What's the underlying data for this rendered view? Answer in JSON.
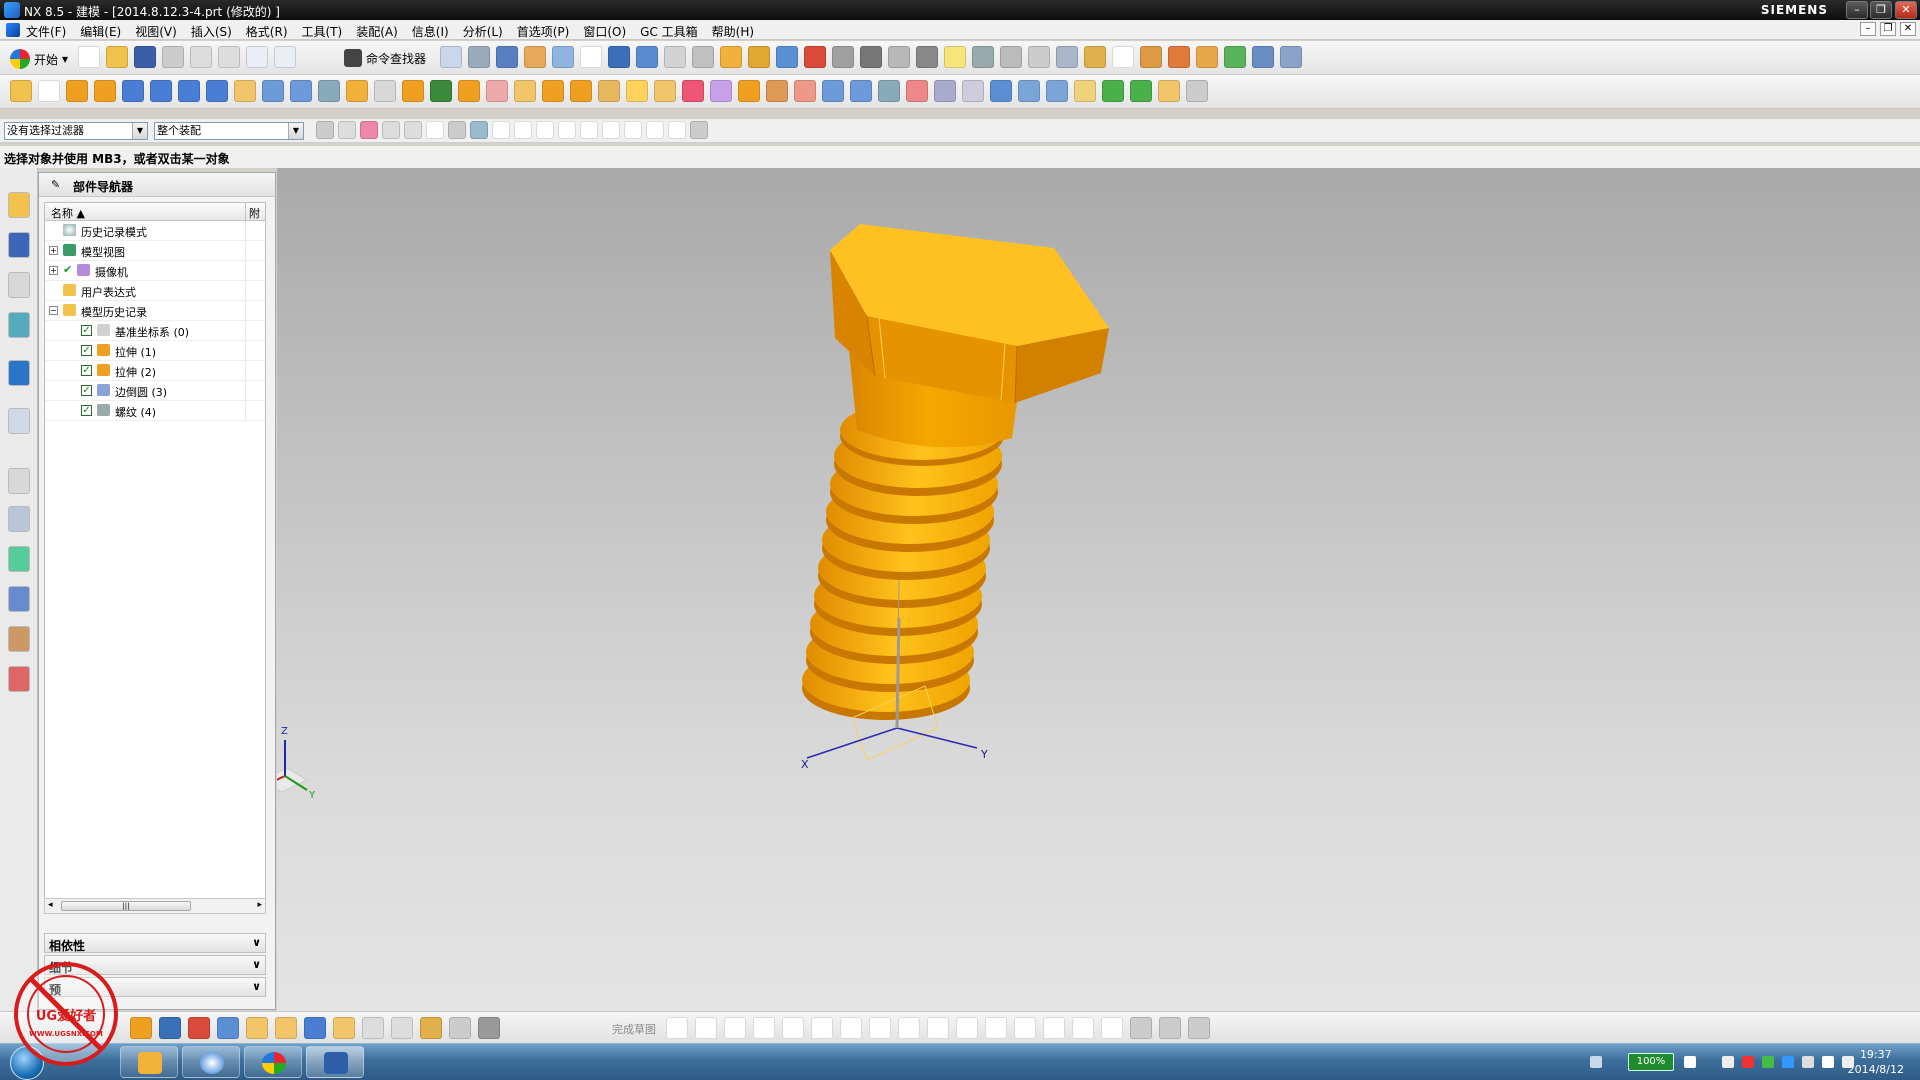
{
  "window": {
    "title": "NX 8.5 - 建模 - [2014.8.12.3-4.prt  (修改的) ]",
    "brand": "SIEMENS",
    "controls": [
      "–",
      "❐",
      "✕"
    ]
  },
  "menu": {
    "items": [
      "文件(F)",
      "编辑(E)",
      "视图(V)",
      "插入(S)",
      "格式(R)",
      "工具(T)",
      "装配(A)",
      "信息(I)",
      "分析(L)",
      "首选项(P)",
      "窗口(O)",
      "GC 工具箱",
      "帮助(H)"
    ]
  },
  "toolbar": {
    "start_label": "开始",
    "command_finder_label": "命令查找器"
  },
  "selection": {
    "filter_value": "没有选择过滤器",
    "scope_value": "整个装配"
  },
  "status": {
    "cue": "选择对象并使用 MB3，或者双击某一对象"
  },
  "navigator": {
    "title": "部件导航器",
    "col_name": "名称",
    "col_attach": "附",
    "items": [
      {
        "label": "历史记录模式"
      },
      {
        "label": "模型视图"
      },
      {
        "label": "摄像机"
      },
      {
        "label": "用户表达式"
      },
      {
        "label": "模型历史记录"
      },
      {
        "label": "基准坐标系 (0)"
      },
      {
        "label": "拉伸 (1)"
      },
      {
        "label": "拉伸 (2)"
      },
      {
        "label": "边倒圆 (3)"
      },
      {
        "label": "螺纹 (4)"
      }
    ],
    "panels": [
      "相依性",
      "细节",
      "预"
    ]
  },
  "viewport": {
    "triad_labels": [
      "X",
      "Y",
      "Z"
    ],
    "part_color": "#F5A800"
  },
  "bottom_toolbar": {
    "finish_sketch": "完成草图"
  },
  "watermark": {
    "text": "UG爱好者",
    "url": "WWW.UGSNX.COM"
  },
  "taskbar": {
    "zoom": "100%",
    "time": "19:37",
    "date": "2014/8/12"
  }
}
